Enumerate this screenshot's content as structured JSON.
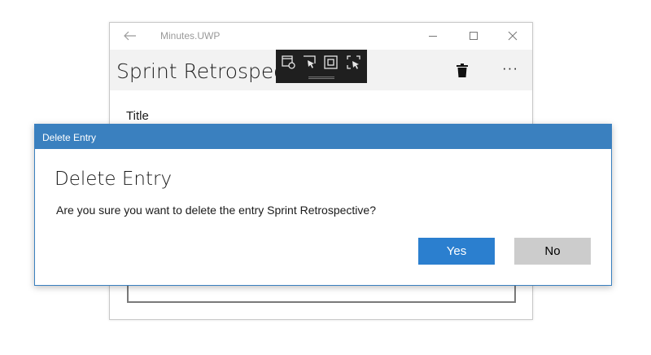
{
  "window": {
    "app_title": "Minutes.UWP",
    "page_title": "Sprint Retrospective",
    "field_label": "Title",
    "more_label": "···"
  },
  "dialog": {
    "titlebar": "Delete Entry",
    "heading": "Delete Entry",
    "message": "Are you sure you want to delete the entry Sprint Retrospective?",
    "yes_label": "Yes",
    "no_label": "No"
  },
  "icons": {
    "back": "back-arrow-icon",
    "minimize": "minimize-icon",
    "maximize": "maximize-icon",
    "close": "close-icon",
    "delete": "trash-icon",
    "more": "more-ellipsis-icon",
    "devtools": [
      "select-element-icon",
      "display-layout-adorners-icon",
      "track-focused-element-icon",
      "toggle-selection-icon"
    ]
  },
  "colors": {
    "dialog_accent": "#3a80bf",
    "primary_button": "#2b7fcf",
    "secondary_button": "#cccccc",
    "command_bar": "#f2f2f2",
    "devtools_bar": "#1f1f1f"
  }
}
